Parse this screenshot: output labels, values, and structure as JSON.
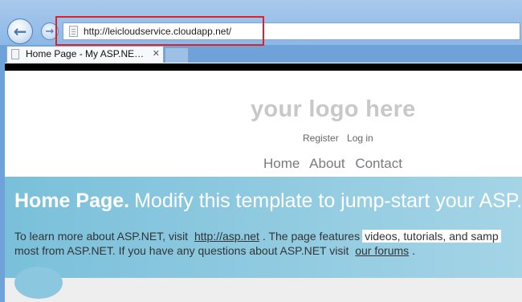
{
  "browser": {
    "url": "http://leicloudservice.cloudapp.net/",
    "tab_title": "Home Page - My ASP.NE…",
    "tab_close": "✕",
    "back_glyph": "←",
    "forward_glyph": "→",
    "icons": [
      "back-arrow-icon",
      "forward-arrow-icon",
      "page-icon",
      "close-icon"
    ],
    "highlight_color": "#d9242b"
  },
  "site": {
    "logo": "your logo here",
    "login_links": [
      "Register",
      "Log in"
    ],
    "nav": [
      "Home",
      "About",
      "Contact"
    ]
  },
  "featured": {
    "title_bold": "Home Page.",
    "title_rest": "Modify this template to jump-start your ASP.",
    "line1_pre": "To learn more about ASP.NET, visit",
    "line1_link": "http://asp.net",
    "line1_mid": ". The page features",
    "line1_highlight": "videos, tutorials, and samp",
    "line2_pre": "most from ASP.NET. If you have any questions about ASP.NET visit",
    "line2_link": "our forums",
    "line2_post": ".",
    "background_color": "#7ac0da"
  }
}
